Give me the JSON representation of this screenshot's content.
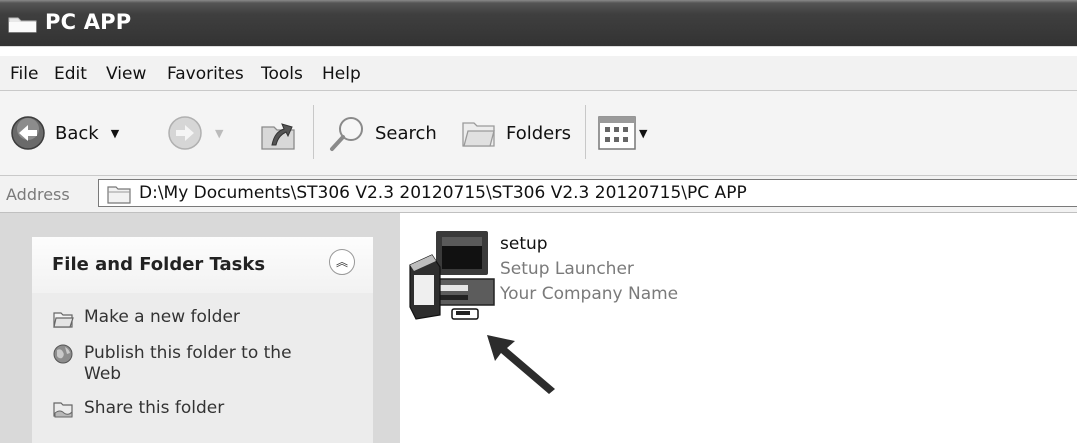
{
  "window": {
    "title": "PC APP",
    "title_icon": "folder-icon"
  },
  "menu": [
    "File",
    "Edit",
    "View",
    "Favorites",
    "Tools",
    "Help"
  ],
  "toolbar": {
    "back_label": "Back",
    "search_label": "Search",
    "folders_label": "Folders"
  },
  "address": {
    "label": "Address",
    "path": "D:\\My Documents\\ST306 V2.3 20120715\\ST306 V2.3 20120715\\PC APP"
  },
  "tasks_panel": {
    "title": "File and Folder Tasks",
    "items": [
      {
        "label": "Make a new folder",
        "icon": "new-folder-icon"
      },
      {
        "label": "Publish this folder to the Web",
        "icon": "globe-icon"
      },
      {
        "label": "Share this folder",
        "icon": "share-folder-icon"
      }
    ]
  },
  "file": {
    "name": "setup",
    "description": "Setup Launcher",
    "company": "Your Company Name",
    "icon": "setup-installer-icon"
  }
}
